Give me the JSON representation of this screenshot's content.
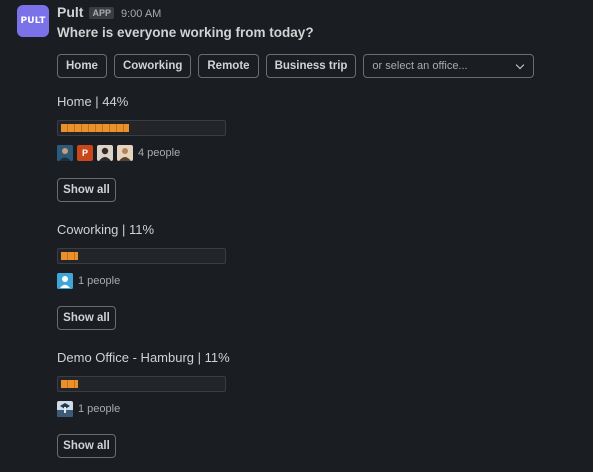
{
  "app": {
    "logo_text": "PULT",
    "sender": "Pult",
    "badge": "APP",
    "time": "9:00 AM"
  },
  "question": "Where is everyone working from today?",
  "actions": {
    "buttons": [
      "Home",
      "Coworking",
      "Remote",
      "Business trip"
    ],
    "select_placeholder": "or select an office..."
  },
  "sections": [
    {
      "title": "Home  |  44%",
      "percent": 44,
      "people_count": "4 people",
      "avatars": [
        {
          "icon": "person-photo-1",
          "color": "#3b6e8f"
        },
        {
          "icon": "letter-avatar",
          "letter": "P",
          "color": "#c8471b"
        },
        {
          "icon": "person-photo-2",
          "color": "#d9d3c9"
        },
        {
          "icon": "person-photo-3",
          "color": "#e5d3bd"
        }
      ],
      "show_all": "Show all"
    },
    {
      "title": "Coworking  |  11%",
      "percent": 11,
      "people_count": "1 people",
      "avatars": [
        {
          "icon": "default-user-icon",
          "color": "#3ea7d8"
        }
      ],
      "show_all": "Show all"
    },
    {
      "title": "Demo Office - Hamburg  |  11%",
      "percent": 11,
      "people_count": "1 people",
      "avatars": [
        {
          "icon": "landscape-photo",
          "color": "#6a8fb0"
        }
      ],
      "show_all": "Show all"
    }
  ],
  "colors": {
    "bar": "#e8912d",
    "app_logo": "#7b72e9",
    "background": "#1a1d21"
  }
}
